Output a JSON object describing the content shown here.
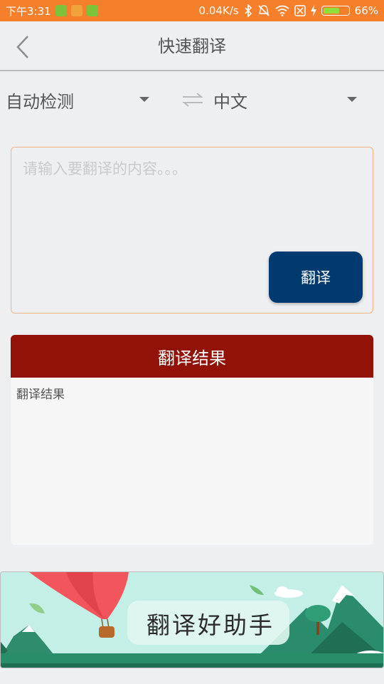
{
  "status_bar": {
    "time": "下午3:31",
    "net_speed": "0.04K/s",
    "battery": "66%",
    "icons": [
      "sim-icon",
      "squirrel-app-icon",
      "android-icon",
      "bluetooth-icon",
      "mute-icon",
      "wifi-icon",
      "no-sim-icon",
      "charging-icon",
      "battery-icon"
    ],
    "battery_level": 0.66
  },
  "nav": {
    "title": "快速翻译",
    "back_icon": "chevron-left-icon"
  },
  "language": {
    "source": "自动检测",
    "target": "中文",
    "swap_icon": "swap-icon",
    "dropdown_icon": "caret-down-icon"
  },
  "input": {
    "placeholder": "请输入要翻译的内容。。。",
    "value": "",
    "button_label": "翻译"
  },
  "result": {
    "header": "翻译结果",
    "text": "翻译结果"
  },
  "banner": {
    "text": "翻译好助手"
  },
  "colors": {
    "status_bar": "#f57f2a",
    "translate_button": "#003a6e",
    "result_header": "#921208",
    "input_border": "#f2b486",
    "background": "#eeeff1"
  }
}
